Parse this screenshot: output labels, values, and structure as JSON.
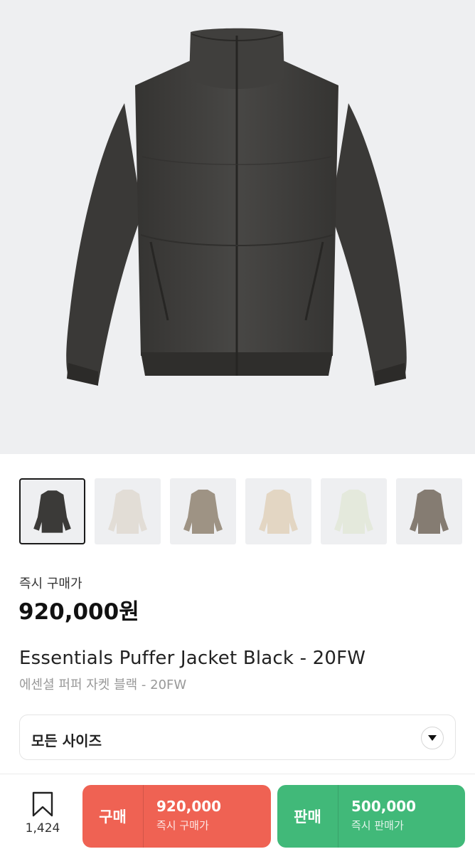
{
  "product": {
    "thumbnails": [
      {
        "name": "thumb-black",
        "color": "#3b3a38",
        "active": true
      },
      {
        "name": "thumb-cream",
        "color": "#e2ddd6",
        "active": false
      },
      {
        "name": "thumb-taupe",
        "color": "#9e9384",
        "active": false
      },
      {
        "name": "thumb-sand",
        "color": "#e3d6c3",
        "active": false
      },
      {
        "name": "thumb-mint",
        "color": "#e4e9dc",
        "active": false
      },
      {
        "name": "thumb-grey",
        "color": "#857c72",
        "active": false
      }
    ],
    "instant_price_label": "즉시 구매가",
    "instant_price": "920,000원",
    "name_en": "Essentials Puffer Jacket Black - 20FW",
    "name_ko": "에센셜 퍼퍼 자켓 블랙 - 20FW",
    "main_color": "#3c3b39"
  },
  "size_selector": {
    "label": "모든 사이즈"
  },
  "bottom_bar": {
    "bookmark_count": "1,424",
    "buy": {
      "type_label": "구매",
      "price": "920,000",
      "sub_label": "즉시 구매가",
      "color": "#ef6253"
    },
    "sell": {
      "type_label": "판매",
      "price": "500,000",
      "sub_label": "즉시 판매가",
      "color": "#41b979"
    }
  }
}
